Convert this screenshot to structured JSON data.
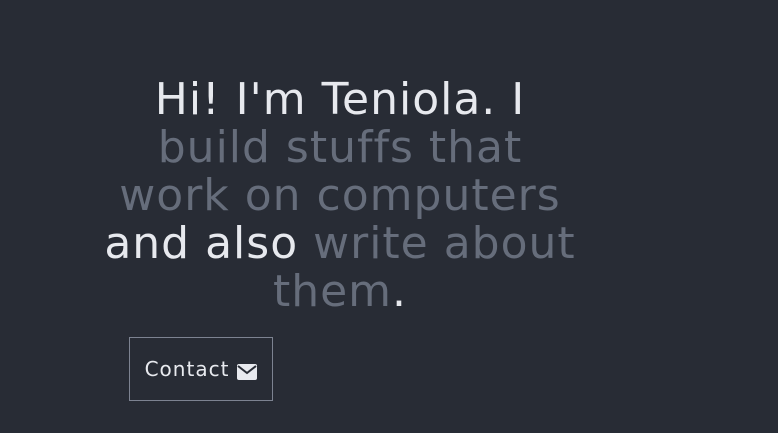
{
  "hero": {
    "line1": "Hi! I'm Teniola. I",
    "line2": "build stuffs that",
    "line3": "work on computers",
    "line4_bright": "and also",
    "line4_dim": " write about",
    "line5_dim": "them",
    "line5_dot": "."
  },
  "contact": {
    "label": "Contact",
    "icon": "envelope-icon"
  },
  "colors": {
    "background": "#282c35",
    "text_bright": "#e7e9ee",
    "text_dim": "#666d7b",
    "button_border": "#7d8391"
  }
}
